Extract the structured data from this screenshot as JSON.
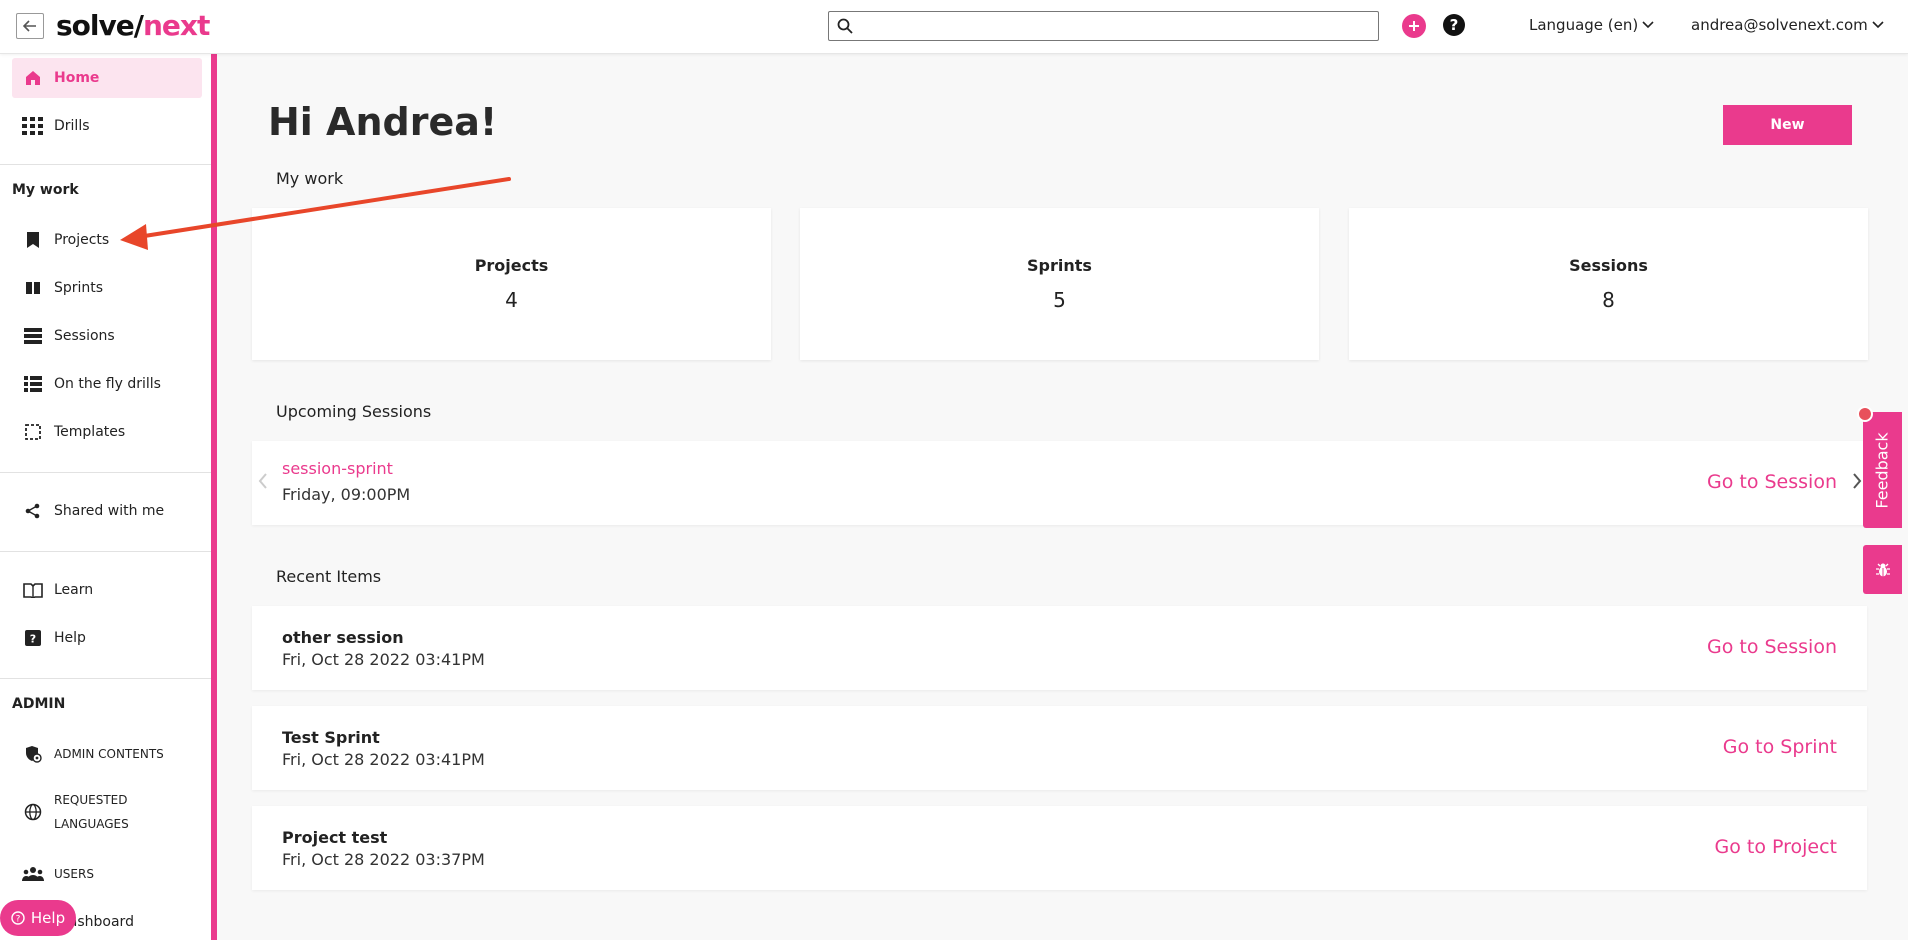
{
  "topbar": {
    "logo_part1": "solve/",
    "logo_part2": "next",
    "search_value": "",
    "language": "Language (en)",
    "user_email": "andrea@solvenext.com"
  },
  "sidebar": {
    "home": "Home",
    "drills": "Drills",
    "my_work_title": "My work",
    "projects": "Projects",
    "sprints": "Sprints",
    "sessions": "Sessions",
    "on_the_fly": "On the fly drills",
    "templates": "Templates",
    "shared": "Shared with me",
    "learn": "Learn",
    "help": "Help",
    "admin_title": "ADMIN",
    "admin_contents": "ADMIN CONTENTS",
    "requested_languages_1": "REQUESTED",
    "requested_languages_2": "LANGUAGES",
    "users": "USERS",
    "dashboard": "Dashboard",
    "help_pill": "Help"
  },
  "main": {
    "greeting": "Hi Andrea!",
    "new_button": "New",
    "my_work_heading": "My work",
    "stats": [
      {
        "label": "Projects",
        "value": "4"
      },
      {
        "label": "Sprints",
        "value": "5"
      },
      {
        "label": "Sessions",
        "value": "8"
      }
    ],
    "upcoming_heading": "Upcoming Sessions",
    "upcoming": {
      "title": "session-sprint",
      "time": "Friday, 09:00PM",
      "action": "Go to Session"
    },
    "recent_heading": "Recent Items",
    "recent": [
      {
        "title": "other session",
        "date": "Fri, Oct 28 2022 03:41PM",
        "action": "Go to Session"
      },
      {
        "title": "Test Sprint",
        "date": "Fri, Oct 28 2022 03:41PM",
        "action": "Go to Sprint"
      },
      {
        "title": "Project test",
        "date": "Fri, Oct 28 2022 03:37PM",
        "action": "Go to Project"
      }
    ]
  },
  "feedback": {
    "label": "Feedback"
  },
  "colors": {
    "accent": "#ea3a8d",
    "annotation_arrow": "#e8462a"
  }
}
